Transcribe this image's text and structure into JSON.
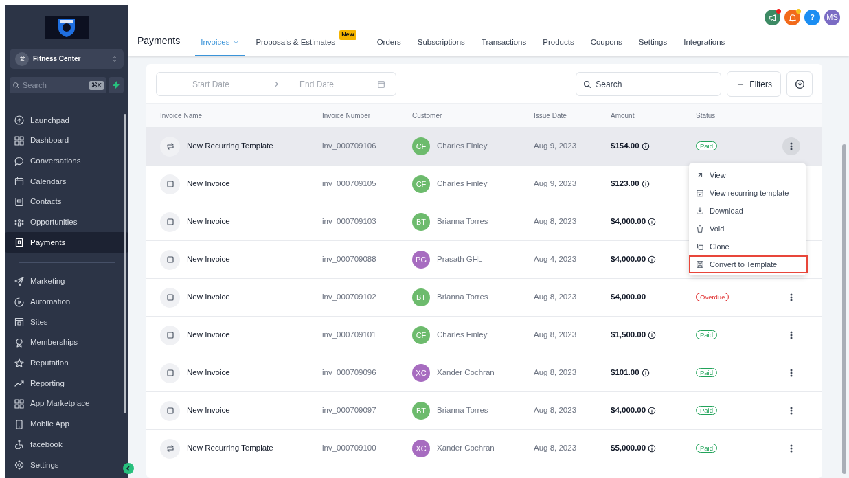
{
  "sidebar": {
    "account": {
      "name": "Fitness Center"
    },
    "search": {
      "placeholder": "Search",
      "shortcut": "⌘K"
    },
    "items": [
      {
        "label": "Launchpad",
        "selected": false
      },
      {
        "label": "Dashboard",
        "selected": false
      },
      {
        "label": "Conversations",
        "selected": false
      },
      {
        "label": "Calendars",
        "selected": false
      },
      {
        "label": "Contacts",
        "selected": false
      },
      {
        "label": "Opportunities",
        "selected": false
      },
      {
        "label": "Payments",
        "selected": true
      }
    ],
    "items_2": [
      {
        "label": "Marketing",
        "selected": false
      },
      {
        "label": "Automation",
        "selected": false
      },
      {
        "label": "Sites",
        "selected": false
      },
      {
        "label": "Memberships",
        "selected": false
      },
      {
        "label": "Reputation",
        "selected": false
      },
      {
        "label": "Reporting",
        "selected": false
      },
      {
        "label": "App Marketplace",
        "selected": false
      },
      {
        "label": "Mobile App",
        "selected": false
      },
      {
        "label": "facebook",
        "selected": false
      }
    ],
    "footer_item": {
      "label": "Settings",
      "selected": false
    }
  },
  "header": {
    "title": "Payments",
    "help": "?",
    "user_initials": "MS",
    "tabs": [
      {
        "label": "Invoices",
        "selected": true,
        "dropdown": true
      },
      {
        "label": "Proposals & Estimates",
        "selected": false,
        "badge": "New"
      },
      {
        "label": "Orders",
        "selected": false
      },
      {
        "label": "Subscriptions",
        "selected": false
      },
      {
        "label": "Transactions",
        "selected": false
      },
      {
        "label": "Products",
        "selected": false
      },
      {
        "label": "Coupons",
        "selected": false
      },
      {
        "label": "Settings",
        "selected": false
      },
      {
        "label": "Integrations",
        "selected": false
      }
    ]
  },
  "toolbar": {
    "start_date": {
      "placeholder": "Start Date"
    },
    "end_date": {
      "placeholder": "End Date"
    },
    "search": {
      "placeholder": "Search"
    },
    "filters": "Filters"
  },
  "table": {
    "columns": [
      "Invoice Name",
      "Invoice Number",
      "Customer",
      "Issue Date",
      "Amount",
      "Status"
    ],
    "rows": [
      {
        "kind": "recurring",
        "name": "New Recurring Template",
        "number": "inv_000709106",
        "customer": {
          "initials": "CF",
          "name": "Charles Finley",
          "color": "#6dbb6d"
        },
        "date": "Aug 9, 2023",
        "amount": "$154.00",
        "info": true,
        "status": {
          "label": "Paid",
          "color": "#22a35a"
        },
        "selected": true
      },
      {
        "kind": "invoice",
        "name": "New Invoice",
        "number": "inv_000709105",
        "customer": {
          "initials": "CF",
          "name": "Charles Finley",
          "color": "#6dbb6d"
        },
        "date": "Aug 9, 2023",
        "amount": "$123.00",
        "info": true,
        "selected": false
      },
      {
        "kind": "invoice",
        "name": "New Invoice",
        "number": "inv_000709103",
        "customer": {
          "initials": "BT",
          "name": "Brianna Torres",
          "color": "#6dbb6d"
        },
        "date": "Aug 8, 2023",
        "amount": "$4,000.00",
        "info": true,
        "selected": false
      },
      {
        "kind": "invoice",
        "name": "New Invoice",
        "number": "inv_000709088",
        "customer": {
          "initials": "PG",
          "name": "Prasath GHL",
          "color": "#a76cc0"
        },
        "date": "Aug 4, 2023",
        "amount": "$4,000.00",
        "info": true,
        "selected": false
      },
      {
        "kind": "invoice",
        "name": "New Invoice",
        "number": "inv_000709102",
        "customer": {
          "initials": "BT",
          "name": "Brianna Torres",
          "color": "#6dbb6d"
        },
        "date": "Aug 8, 2023",
        "amount": "$4,000.00",
        "info": false,
        "status": {
          "label": "Overdue",
          "color": "#e02d2d"
        },
        "selected": false
      },
      {
        "kind": "invoice",
        "name": "New Invoice",
        "number": "inv_000709101",
        "customer": {
          "initials": "CF",
          "name": "Charles Finley",
          "color": "#6dbb6d"
        },
        "date": "Aug 8, 2023",
        "amount": "$1,500.00",
        "info": true,
        "status": {
          "label": "Paid",
          "color": "#22a35a"
        },
        "selected": false
      },
      {
        "kind": "invoice",
        "name": "New Invoice",
        "number": "inv_000709096",
        "customer": {
          "initials": "XC",
          "name": "Xander Cochran",
          "color": "#a76cc0"
        },
        "date": "Aug 8, 2023",
        "amount": "$101.00",
        "info": true,
        "status": {
          "label": "Paid",
          "color": "#22a35a"
        },
        "selected": false
      },
      {
        "kind": "invoice",
        "name": "New Invoice",
        "number": "inv_000709097",
        "customer": {
          "initials": "BT",
          "name": "Brianna Torres",
          "color": "#6dbb6d"
        },
        "date": "Aug 8, 2023",
        "amount": "$4,000.00",
        "info": true,
        "status": {
          "label": "Paid",
          "color": "#22a35a"
        },
        "selected": false
      },
      {
        "kind": "recurring",
        "name": "New Recurring Template",
        "number": "inv_000709100",
        "customer": {
          "initials": "XC",
          "name": "Xander Cochran",
          "color": "#a76cc0"
        },
        "date": "Aug 8, 2023",
        "amount": "$5,000.00",
        "info": true,
        "status": {
          "label": "Paid",
          "color": "#22a35a"
        },
        "selected": false
      }
    ]
  },
  "row_menu": {
    "items": [
      {
        "label": "View",
        "highlighted": false
      },
      {
        "label": "View recurring template",
        "highlighted": false
      },
      {
        "label": "Download",
        "highlighted": false
      },
      {
        "label": "Void",
        "highlighted": false
      },
      {
        "label": "Clone",
        "highlighted": false
      },
      {
        "label": "Convert to Template",
        "highlighted": true
      }
    ]
  }
}
